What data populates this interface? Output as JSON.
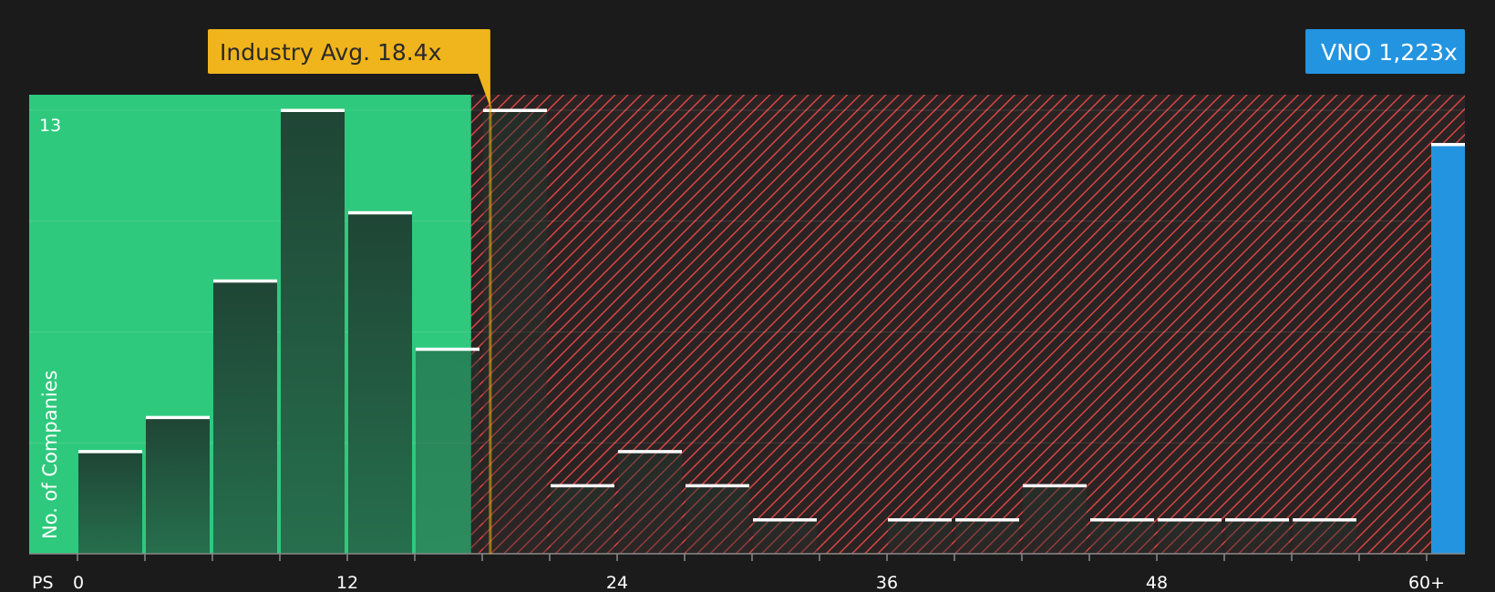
{
  "chart_data": {
    "type": "bar",
    "xlabel": "PS",
    "ylabel": "No. of Companies",
    "x_ticks": [
      "0",
      "12",
      "24",
      "36",
      "48",
      "60+"
    ],
    "y_ticks": [
      "13"
    ],
    "ylim": [
      0,
      13.5
    ],
    "bin_width": 3,
    "bins": [
      {
        "start": 0,
        "value": 3
      },
      {
        "start": 3,
        "value": 4
      },
      {
        "start": 6,
        "value": 8
      },
      {
        "start": 9,
        "value": 13
      },
      {
        "start": 12,
        "value": 10
      },
      {
        "start": 15,
        "value": 6
      },
      {
        "start": 18,
        "value": 13
      },
      {
        "start": 21,
        "value": 2
      },
      {
        "start": 24,
        "value": 3
      },
      {
        "start": 27,
        "value": 2
      },
      {
        "start": 30,
        "value": 1
      },
      {
        "start": 33,
        "value": 0
      },
      {
        "start": 36,
        "value": 1
      },
      {
        "start": 39,
        "value": 1
      },
      {
        "start": 42,
        "value": 2
      },
      {
        "start": 45,
        "value": 1
      },
      {
        "start": 48,
        "value": 1
      },
      {
        "start": 51,
        "value": 1
      },
      {
        "start": 54,
        "value": 1
      },
      {
        "start": 57,
        "value": 0
      }
    ],
    "industry_avg": {
      "label": "Industry Avg. 18.4x",
      "value": 18.4
    },
    "company": {
      "label": "VNO 1,223x",
      "value": 1223,
      "bin": "60+",
      "bar_value": 12
    },
    "colors": {
      "undervalued_zone": "#2ec97d",
      "overvalued_zone": "#d64545",
      "bar_fill": "#1f4a3a",
      "bar_cap": "#ffffff",
      "industry_callout": "#f0b41c",
      "company_bar": "#2394e0",
      "background": "#1b1b1b"
    },
    "grid": true
  }
}
